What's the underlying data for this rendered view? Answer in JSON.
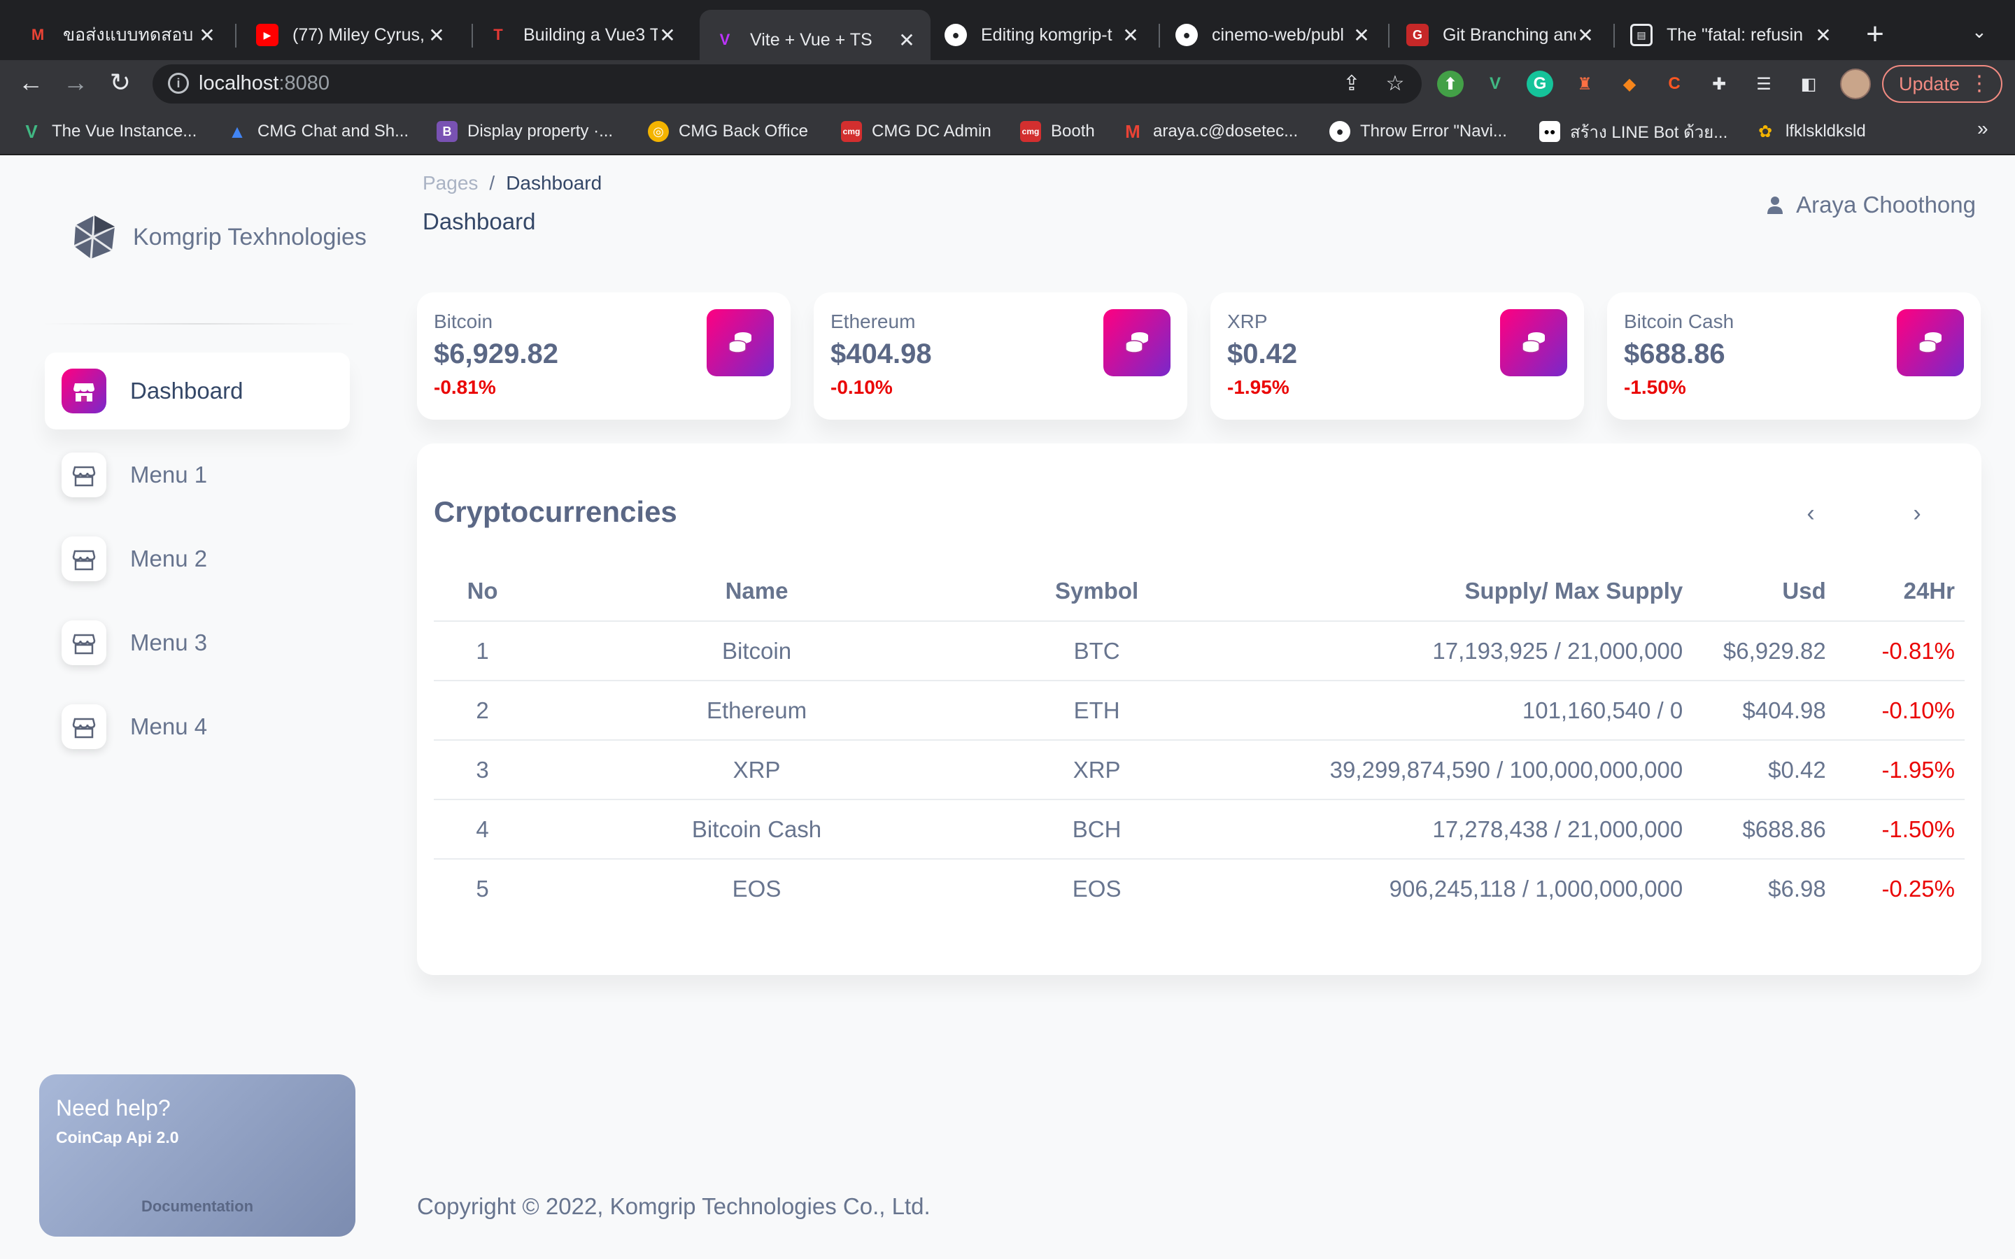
{
  "browser": {
    "tabs": [
      {
        "title": "ขอส่งแบบทดสอบ V",
        "icon": "gmail-icon",
        "fav": "M",
        "color": "#ea4335"
      },
      {
        "title": "(77) Miley Cyrus,",
        "icon": "youtube-icon",
        "fav": "▶",
        "color": "#ff0000"
      },
      {
        "title": "Building a Vue3 T",
        "icon": "blog-icon",
        "fav": "T",
        "color": "#d32f2f"
      },
      {
        "title": "Vite + Vue + TS",
        "icon": "vite-icon",
        "fav": "V",
        "color": "#7c4dff"
      },
      {
        "title": "Editing komgrip-t",
        "icon": "github-icon",
        "fav": "●",
        "color": "#ffffff"
      },
      {
        "title": "cinemo-web/publ",
        "icon": "github-icon",
        "fav": "●",
        "color": "#ffffff"
      },
      {
        "title": "Git Branching and",
        "icon": "git-icon",
        "fav": "G",
        "color": "#c62828"
      },
      {
        "title": "The \"fatal: refusin",
        "icon": "page-icon",
        "fav": "▤",
        "color": "#5f6368"
      }
    ],
    "active_tab": 3,
    "url_host": "localhost",
    "url_port": ":8080",
    "update_label": "Update",
    "bookmarks": [
      {
        "label": "The Vue Instance...",
        "icon": "vue-icon",
        "color": "#41b883"
      },
      {
        "label": "CMG Chat and Sh...",
        "icon": "cmg-chat-icon",
        "color": "#4285f4"
      },
      {
        "label": "Display property ·...",
        "icon": "bootstrap-icon",
        "color": "#7952b3"
      },
      {
        "label": "CMG Back Office",
        "icon": "cmg-icon",
        "color": "#f4b400"
      },
      {
        "label": "CMG DC Admin",
        "icon": "cmg-dc-icon",
        "color": "#d32f2f"
      },
      {
        "label": "Booth",
        "icon": "booth-icon",
        "color": "#d32f2f"
      },
      {
        "label": "araya.c@dosetec...",
        "icon": "gmail-icon",
        "color": "#ea4335"
      },
      {
        "label": "Throw Error \"Navi...",
        "icon": "github-icon",
        "color": "#ffffff"
      },
      {
        "label": "สร้าง LINE Bot ด้วย...",
        "icon": "medium-icon",
        "color": "#000000"
      },
      {
        "label": "lfklskldksld",
        "icon": "custom-icon",
        "color": "#f4b400"
      }
    ]
  },
  "sidebar": {
    "brand": "Komgrip Texhnologies",
    "items": [
      {
        "label": "Dashboard",
        "active": true
      },
      {
        "label": "Menu 1",
        "active": false
      },
      {
        "label": "Menu 2",
        "active": false
      },
      {
        "label": "Menu 3",
        "active": false
      },
      {
        "label": "Menu 4",
        "active": false
      }
    ],
    "help": {
      "title": "Need help?",
      "subtitle": "CoinCap Api 2.0",
      "button": "Documentation"
    }
  },
  "header": {
    "breadcrumb_root": "Pages",
    "breadcrumb_sep": "/",
    "breadcrumb_current": "Dashboard",
    "title": "Dashboard",
    "user": "Araya Choothong"
  },
  "stats": [
    {
      "name": "Bitcoin",
      "price": "$6,929.82",
      "change": "-0.81%"
    },
    {
      "name": "Ethereum",
      "price": "$404.98",
      "change": "-0.10%"
    },
    {
      "name": "XRP",
      "price": "$0.42",
      "change": "-1.95%"
    },
    {
      "name": "Bitcoin Cash",
      "price": "$688.86",
      "change": "-1.50%"
    }
  ],
  "table": {
    "title": "Cryptocurrencies",
    "columns": [
      "No",
      "Name",
      "Symbol",
      "Supply/ Max Supply",
      "Usd",
      "24Hr"
    ],
    "rows": [
      [
        "1",
        "Bitcoin",
        "BTC",
        "17,193,925 / 21,000,000",
        "$6,929.82",
        "-0.81%"
      ],
      [
        "2",
        "Ethereum",
        "ETH",
        "101,160,540 / 0",
        "$404.98",
        "-0.10%"
      ],
      [
        "3",
        "XRP",
        "XRP",
        "39,299,874,590 / 100,000,000,000",
        "$0.42",
        "-1.95%"
      ],
      [
        "4",
        "Bitcoin Cash",
        "BCH",
        "17,278,438 / 21,000,000",
        "$688.86",
        "-1.50%"
      ],
      [
        "5",
        "EOS",
        "EOS",
        "906,245,118 / 1,000,000,000",
        "$6.98",
        "-0.25%"
      ]
    ]
  },
  "footer": "Copyright © 2022, Komgrip Technologies Co., Ltd.",
  "colors": {
    "accent_gradient_start": "#7928ca",
    "accent_gradient_end": "#ff0080",
    "negative": "#ea0606",
    "text": "#344767",
    "muted": "#67748e"
  }
}
